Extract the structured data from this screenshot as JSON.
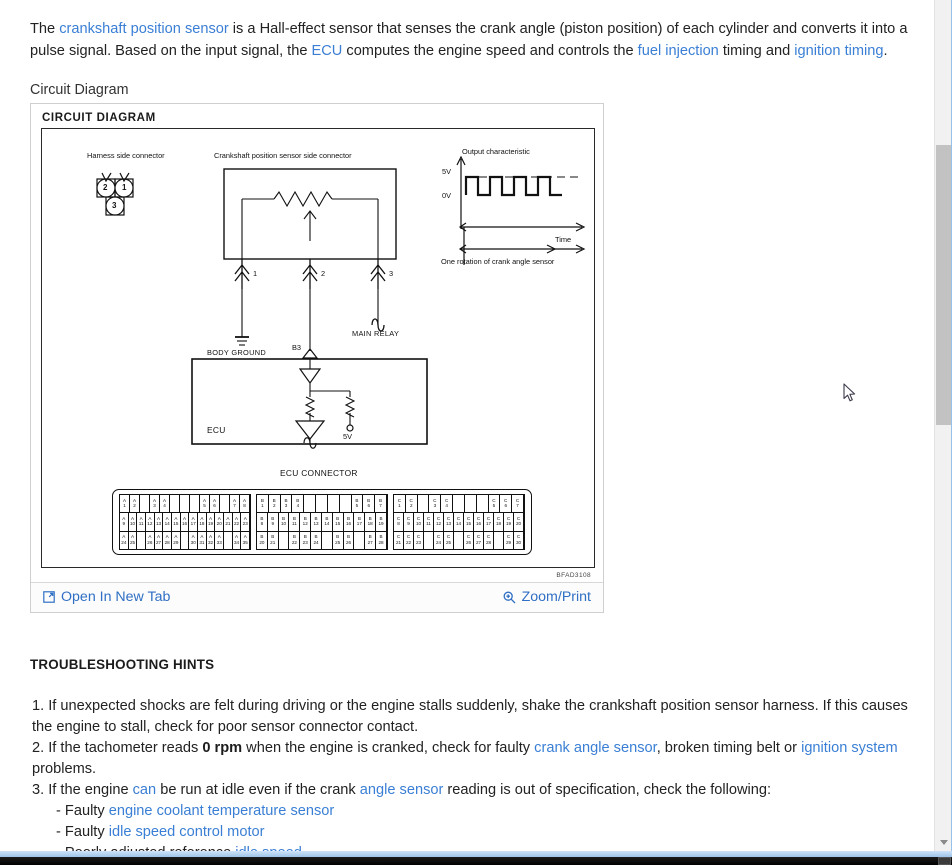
{
  "article": {
    "intro_segments": [
      {
        "t": "The ",
        "link": false
      },
      {
        "t": "crankshaft position sensor",
        "link": true
      },
      {
        "t": " is a Hall-effect sensor that senses the crank angle (piston position) of each cylinder and converts it into a pulse signal. Based on the input signal, the ",
        "link": false
      },
      {
        "t": "ECU",
        "link": true
      },
      {
        "t": " computes the engine speed and controls the ",
        "link": false
      },
      {
        "t": "fuel injection",
        "link": true
      },
      {
        "t": " timing and ",
        "link": false
      },
      {
        "t": "ignition timing",
        "link": true
      },
      {
        "t": ".",
        "link": false
      }
    ]
  },
  "figure": {
    "caption": "Circuit Diagram",
    "title": "CIRCUIT DIAGRAM",
    "image_code": "BFAD3108",
    "open_new_tab_label": "Open In New Tab",
    "zoom_print_label": "Zoom/Print",
    "diagram": {
      "harness_label": "Harness side connector",
      "harness_pins": [
        "2",
        "1",
        "3"
      ],
      "sensor_label": "Crankshaft position sensor side connector",
      "terminal_numbers": [
        "1",
        "2",
        "3"
      ],
      "body_ground_label": "BODY GROUND",
      "main_relay_label": "MAIN RELAY",
      "b3_label": "B3",
      "ecu_label": "ECU",
      "ecu_voltage_label": "5V",
      "ecu_connector_label": "ECU CONNECTOR",
      "output": {
        "title": "Output characteristic",
        "y_high": "5V",
        "y_low": "0V",
        "x_label": "Time",
        "caption": "One rotation of crank angle sensor"
      },
      "connector_blocks": [
        {
          "prefix": "A",
          "rows": [
            [
              "1",
              "2",
              "",
              "3",
              "4",
              "",
              "",
              "",
              "5",
              "6",
              "",
              "7",
              "8"
            ],
            [
              "9",
              "10",
              "11",
              "12",
              "13",
              "14",
              "15",
              "16",
              "17",
              "18",
              "19",
              "20",
              "21",
              "22",
              "23"
            ],
            [
              "24",
              "25",
              "",
              "26",
              "27",
              "28",
              "29",
              "",
              "30",
              "31",
              "32",
              "33",
              "",
              "34",
              "35"
            ]
          ]
        },
        {
          "prefix": "B",
          "rows": [
            [
              "1",
              "2",
              "3",
              "4",
              "",
              "",
              "",
              "",
              "5",
              "6",
              "7"
            ],
            [
              "8",
              "9",
              "10",
              "11",
              "12",
              "13",
              "14",
              "15",
              "16",
              "17",
              "18",
              "19"
            ],
            [
              "20",
              "21",
              "",
              "22",
              "23",
              "24",
              "",
              "25",
              "26",
              "",
              "27",
              "28"
            ]
          ]
        },
        {
          "prefix": "C",
          "rows": [
            [
              "1",
              "2",
              "",
              "3",
              "4",
              "",
              "",
              "",
              "5",
              "6",
              "7"
            ],
            [
              "8",
              "9",
              "10",
              "11",
              "12",
              "13",
              "14",
              "15",
              "16",
              "17",
              "18",
              "19",
              "20"
            ],
            [
              "21",
              "22",
              "23",
              "",
              "24",
              "25",
              "",
              "26",
              "27",
              "28",
              "",
              "29",
              "30"
            ]
          ]
        }
      ]
    }
  },
  "troubleshooting": {
    "heading": "TROUBLESHOOTING HINTS",
    "items": [
      {
        "number": "1.",
        "segments": [
          {
            "t": "If unexpected shocks are felt during driving or the engine stalls suddenly, shake the crankshaft position sensor harness. If this causes the engine to stall, check for poor sensor connector contact.",
            "link": false
          }
        ]
      },
      {
        "number": "2.",
        "segments": [
          {
            "t": "If the tachometer reads ",
            "link": false
          },
          {
            "t": "0 rpm",
            "link": false,
            "bold": true
          },
          {
            "t": " when the engine is cranked, check for faulty ",
            "link": false
          },
          {
            "t": "crank angle sensor",
            "link": true
          },
          {
            "t": ", broken timing belt or ",
            "link": false
          },
          {
            "t": "ignition system",
            "link": true
          },
          {
            "t": " problems.",
            "link": false
          }
        ]
      },
      {
        "number": "3.",
        "segments": [
          {
            "t": "If the engine ",
            "link": false
          },
          {
            "t": "can",
            "link": true
          },
          {
            "t": " be run at idle even if the crank ",
            "link": false
          },
          {
            "t": "angle sensor",
            "link": true
          },
          {
            "t": " reading is out of specification, check the following:",
            "link": false
          }
        ],
        "subitems": [
          {
            "bullet": "-",
            "segments": [
              {
                "t": "Faulty ",
                "link": false
              },
              {
                "t": "engine coolant temperature sensor",
                "link": true
              }
            ]
          },
          {
            "bullet": "-",
            "segments": [
              {
                "t": "Faulty ",
                "link": false
              },
              {
                "t": "idle speed control motor",
                "link": true
              }
            ]
          },
          {
            "bullet": "-",
            "segments": [
              {
                "t": "Poorly adjusted reference ",
                "link": false
              },
              {
                "t": "idle speed",
                "link": true
              }
            ]
          }
        ]
      }
    ]
  },
  "scrollbar": {
    "down_arrow": "scroll-down-arrow"
  },
  "colors": {
    "link": "#3a7fd5",
    "text": "#222222",
    "scroll_thumb": "#c2c2c2"
  }
}
